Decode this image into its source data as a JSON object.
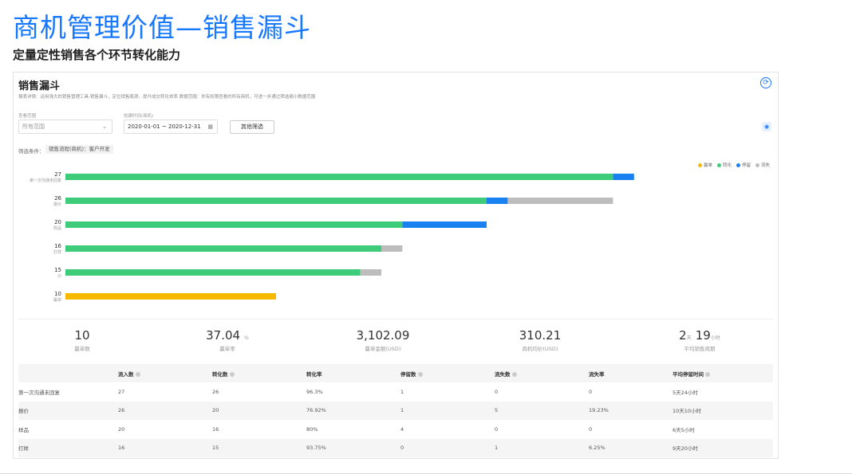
{
  "slide": {
    "title": "商机管理价值—销售漏斗",
    "subtitle": "定量定性销售各个环节转化能力"
  },
  "panel": {
    "title": "销售漏斗",
    "description": "报表详情：运用强大的销售管理工具-销售漏斗，定位销售瓶颈，提升成交转化效率 数据范围：你有权限查看的所有商机，可进一步通过筛选缩小数据范围",
    "scope_label": "查看范围",
    "scope_value": "所有范围",
    "date_label": "创建时间(商机)",
    "date_value": "2020-01-01 ~ 2020-12-31",
    "filter_button": "其他筛选",
    "condition_label": "筛选条件：",
    "condition_tag": "销售流程(商机)：客户开发"
  },
  "colors": {
    "won": "#f7b900",
    "converted": "#3fcc7a",
    "stalled": "#1a82f0",
    "lost": "#bdbdbd",
    "accent": "#1677ff"
  },
  "legend": [
    "赢单",
    "转化",
    "停留",
    "流失"
  ],
  "chart_data": {
    "type": "bar",
    "orientation": "horizontal-stacked",
    "categories": [
      "第一次沟通未回复",
      "报价",
      "样品",
      "打样",
      "兴",
      "赢单"
    ],
    "totals": [
      27,
      26,
      20,
      16,
      15,
      10
    ],
    "series": [
      {
        "name": "赢单",
        "values": [
          0,
          0,
          0,
          0,
          0,
          10
        ]
      },
      {
        "name": "转化",
        "values": [
          26,
          20,
          16,
          15,
          14,
          0
        ]
      },
      {
        "name": "停留",
        "values": [
          1,
          1,
          4,
          0,
          0,
          0
        ]
      },
      {
        "name": "流失",
        "values": [
          0,
          5,
          0,
          1,
          1,
          0
        ]
      }
    ],
    "xlim": [
      0,
      27
    ],
    "grid": false,
    "legend_position": "top-right"
  },
  "stats": [
    {
      "value": "10",
      "unit": "",
      "label": "赢单数"
    },
    {
      "value": "37.04",
      "unit": "%",
      "label": "赢单率"
    },
    {
      "value": "3,102.09",
      "unit": "",
      "label": "赢单金额(USD)"
    },
    {
      "value": "310.21",
      "unit": "",
      "label": "商机均价(USD)"
    },
    {
      "value": "2",
      "unit": "天",
      "value2": "19",
      "unit2": "小时",
      "label": "平均销售周期"
    }
  ],
  "table": {
    "headers": [
      "",
      "流入数",
      "转化数",
      "转化率",
      "停留数",
      "流失数",
      "流失率",
      "平均停留时间"
    ],
    "rows": [
      [
        "第一次沟通未回复",
        "27",
        "26",
        "96.3%",
        "1",
        "0",
        "0",
        "5天24小时"
      ],
      [
        "报价",
        "26",
        "20",
        "76.92%",
        "1",
        "5",
        "19.23%",
        "10天10小时"
      ],
      [
        "样品",
        "20",
        "16",
        "80%",
        "4",
        "0",
        "0",
        "6天5小时"
      ],
      [
        "打样",
        "16",
        "15",
        "93.75%",
        "0",
        "1",
        "6.25%",
        "9天20小时"
      ]
    ]
  }
}
